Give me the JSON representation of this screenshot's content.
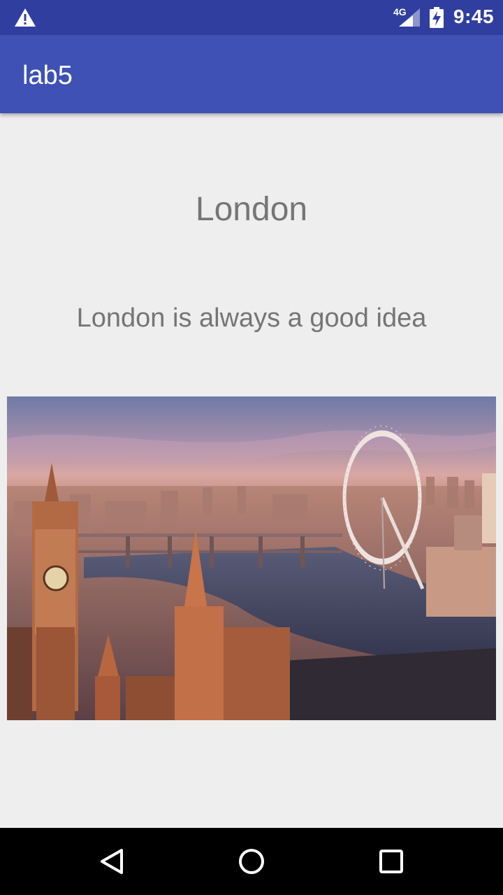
{
  "status_bar": {
    "network_label": "4G",
    "time": "9:45",
    "icons": [
      "warning-icon",
      "signal-icon",
      "battery-charging-icon"
    ]
  },
  "app_bar": {
    "title": "lab5"
  },
  "main": {
    "title": "London",
    "subtitle": "London is always a good idea",
    "image": {
      "subject": "london-skyline-photo"
    }
  },
  "nav_bar": {
    "icons": [
      "back-icon",
      "home-icon",
      "recents-icon"
    ]
  },
  "colors": {
    "status_bar": "#303f9f",
    "app_bar": "#3f51b5",
    "background": "#eeeeee",
    "text_secondary": "#757575"
  }
}
